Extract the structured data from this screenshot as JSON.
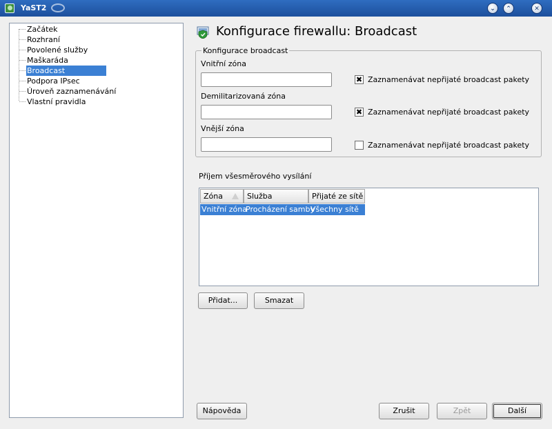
{
  "window": {
    "title": "YaST2"
  },
  "sidebar": {
    "items": [
      {
        "label": "Začátek"
      },
      {
        "label": "Rozhraní"
      },
      {
        "label": "Povolené služby"
      },
      {
        "label": "Maškaráda"
      },
      {
        "label": "Broadcast",
        "selected": true
      },
      {
        "label": "Podpora IPsec"
      },
      {
        "label": "Úroveň zaznamenávání"
      },
      {
        "label": "Vlastní pravidla"
      }
    ]
  },
  "page": {
    "title": "Konfigurace firewallu: Broadcast",
    "icon": "firewall-shield-icon"
  },
  "broadcast_config": {
    "group_title": "Konfigurace broadcast",
    "internal_zone": {
      "label": "Vnitřní zóna",
      "value": "",
      "log_label": "Zaznamenávat nepřijaté broadcast pakety",
      "log_checked": true
    },
    "dmz_zone": {
      "label": "Demilitarizovaná zóna",
      "value": "",
      "log_label": "Zaznamenávat nepřijaté broadcast pakety",
      "log_checked": true
    },
    "external_zone": {
      "label": "Vnější zóna",
      "value": "",
      "log_label": "Zaznamenávat nepřijaté broadcast pakety",
      "log_checked": false
    }
  },
  "reception": {
    "title": "Příjem všesměrového vysílání",
    "columns": [
      "Zóna",
      "Služba",
      "Přijaté ze sítě"
    ],
    "rows": [
      {
        "zone": "Vnitřní zóna",
        "service": "Procházení samby",
        "from": "Všechny sítě",
        "selected": true
      }
    ],
    "add_label": "Přidat...",
    "delete_label": "Smazat"
  },
  "footer": {
    "help_label": "Nápověda",
    "cancel_label": "Zrušit",
    "back_label": "Zpět",
    "next_label": "Další"
  },
  "colors": {
    "titlebar": "#2a63b4",
    "selection": "#3b80d4",
    "background": "#efefef"
  }
}
